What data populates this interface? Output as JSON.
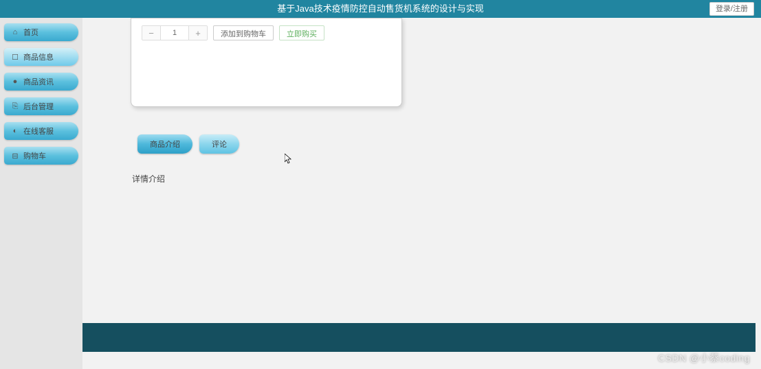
{
  "header": {
    "title": "基于Java技术疫情防控自动售货机系统的设计与实现",
    "login_label": "登录/注册"
  },
  "sidebar": {
    "items": [
      {
        "icon": "home-icon",
        "label": "首页",
        "glyph": "⌂"
      },
      {
        "icon": "product-icon",
        "label": "商品信息",
        "glyph": "☐"
      },
      {
        "icon": "news-icon",
        "label": "商品资讯",
        "glyph": "●"
      },
      {
        "icon": "admin-icon",
        "label": "后台管理",
        "glyph": "⎘"
      },
      {
        "icon": "service-icon",
        "label": "在线客服",
        "glyph": "◐"
      },
      {
        "icon": "cart-icon",
        "label": "购物车",
        "glyph": "⊟"
      }
    ],
    "active_index": 1
  },
  "product": {
    "quantity": "1",
    "minus": "−",
    "plus": "+",
    "add_cart_label": "添加到购物车",
    "buy_now_label": "立即购买"
  },
  "tabs": {
    "items": [
      {
        "label": "商品介绍"
      },
      {
        "label": "评论"
      }
    ],
    "active_index": 0
  },
  "detail": {
    "heading": "详情介绍"
  },
  "watermark": "CSDN @小蔡coding"
}
